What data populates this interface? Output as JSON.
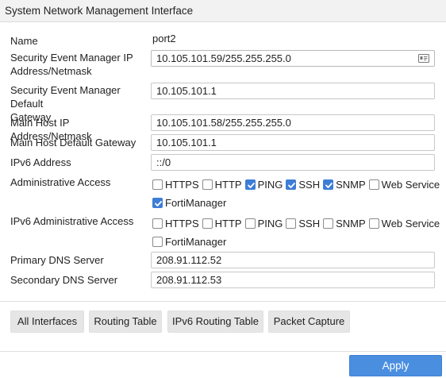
{
  "window": {
    "title": "System Network Management Interface"
  },
  "form": {
    "name_label": "Name",
    "name_value": "port2",
    "sem_ip_label_line1": "Security Event Manager IP",
    "sem_ip_label_line2": "Address/Netmask",
    "sem_ip_value": "10.105.101.59/255.255.255.0",
    "sem_gw_label_line1": "Security Event Manager Default",
    "sem_gw_label_line2": "Gateway",
    "sem_gw_value": "10.105.101.1",
    "host_ip_label": "Main Host IP Address/Netmask",
    "host_ip_value": "10.105.101.58/255.255.255.0",
    "host_gw_label": "Main Host Default Gateway",
    "host_gw_value": "10.105.101.1",
    "ipv6_label": "IPv6 Address",
    "ipv6_value": "::/0",
    "admin_access_label": "Administrative Access",
    "admin_access": [
      {
        "label": "HTTPS",
        "checked": false
      },
      {
        "label": "HTTP",
        "checked": false
      },
      {
        "label": "PING",
        "checked": true
      },
      {
        "label": "SSH",
        "checked": true
      },
      {
        "label": "SNMP",
        "checked": true
      },
      {
        "label": "Web Service",
        "checked": false
      },
      {
        "label": "FortiManager",
        "checked": true
      }
    ],
    "ipv6_admin_access_label": "IPv6 Administrative Access",
    "ipv6_admin_access": [
      {
        "label": "HTTPS",
        "checked": false
      },
      {
        "label": "HTTP",
        "checked": false
      },
      {
        "label": "PING",
        "checked": false
      },
      {
        "label": "SSH",
        "checked": false
      },
      {
        "label": "SNMP",
        "checked": false
      },
      {
        "label": "Web Service",
        "checked": false
      },
      {
        "label": "FortiManager",
        "checked": false
      }
    ],
    "dns1_label": "Primary DNS Server",
    "dns1_value": "208.91.112.52",
    "dns2_label": "Secondary DNS Server",
    "dns2_value": "208.91.112.53"
  },
  "buttons": {
    "all_interfaces": "All Interfaces",
    "routing_table": "Routing Table",
    "ipv6_routing_table": "IPv6 Routing Table",
    "packet_capture": "Packet Capture",
    "apply": "Apply"
  },
  "colors": {
    "accent": "#3d7dd6",
    "apply": "#4a8ee0"
  }
}
